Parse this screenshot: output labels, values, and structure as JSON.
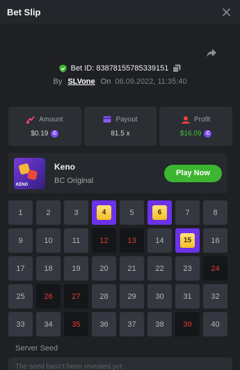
{
  "header": {
    "title": "Bet Slip"
  },
  "bet": {
    "id_label": "Bet ID: 838781557853391​51",
    "by": "By",
    "user": "SLVone",
    "on": "On",
    "date": "06.09.2022, 11:35:40"
  },
  "stats": [
    {
      "label": "Amount",
      "value": "$0.19",
      "coin": true,
      "color": "#d8d8d8"
    },
    {
      "label": "Payout",
      "value": "81.5 x",
      "coin": false,
      "color": "#d8d8d8"
    },
    {
      "label": "Profit",
      "value": "$16.09",
      "coin": true,
      "color": "#41c342"
    }
  ],
  "game": {
    "name": "Keno",
    "subtitle": "BC Original",
    "thumb_label": "KENO",
    "play_label": "Play Now"
  },
  "grid": {
    "numbers": [
      1,
      2,
      3,
      4,
      5,
      6,
      7,
      8,
      9,
      10,
      11,
      12,
      13,
      14,
      15,
      16,
      17,
      18,
      19,
      20,
      21,
      22,
      23,
      24,
      25,
      26,
      27,
      28,
      29,
      30,
      31,
      32,
      33,
      34,
      35,
      36,
      37,
      38,
      39,
      40
    ],
    "selected_hits": [
      4,
      6,
      15
    ],
    "drawn_misses": [
      12,
      13,
      24,
      26,
      27,
      35,
      39
    ]
  },
  "seed": {
    "label": "Server Seed",
    "placeholder": "The seed hasn't been revealed yet"
  },
  "colors": {
    "accent_green": "#3db531",
    "selected_purple": "#6c32e8",
    "hit_red": "#e63a3a"
  },
  "icons": {
    "close": "close-icon",
    "share": "share-icon",
    "verified": "shield-check-icon",
    "copy": "copy-icon",
    "amount": "amount-icon",
    "payout": "payout-icon",
    "profit": "profit-icon"
  }
}
